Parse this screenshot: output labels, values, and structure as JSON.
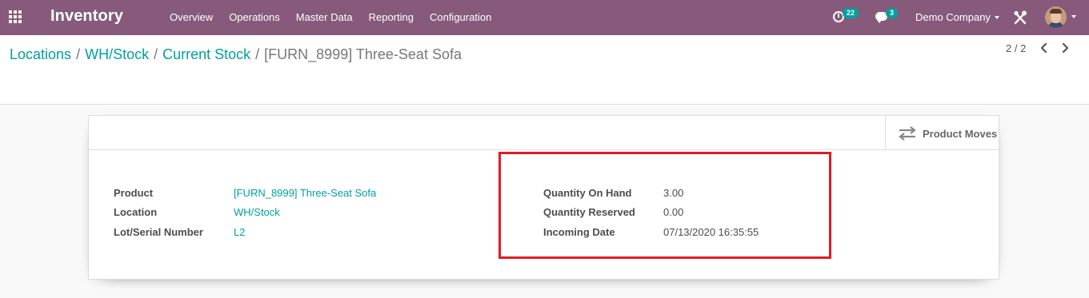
{
  "navbar": {
    "app_title": "Inventory",
    "menu": [
      "Overview",
      "Operations",
      "Master Data",
      "Reporting",
      "Configuration"
    ],
    "activity_count": "22",
    "message_count": "3",
    "company": "Demo Company",
    "icons": [
      "apps-grid-icon",
      "activity-clock-icon",
      "chat-bubble-icon",
      "tools-icon",
      "user-avatar"
    ]
  },
  "breadcrumb": {
    "items": [
      "Locations",
      "WH/Stock",
      "Current Stock"
    ],
    "separator": "/",
    "current": "[FURN_8999] Three-Seat Sofa"
  },
  "pager": {
    "value": "2 / 2"
  },
  "form": {
    "button_box": {
      "product_moves_label": "Product Moves"
    },
    "left": {
      "product_label": "Product",
      "product_value": "[FURN_8999] Three-Seat Sofa",
      "location_label": "Location",
      "location_value": "WH/Stock",
      "lot_label": "Lot/Serial Number",
      "lot_value": "L2"
    },
    "right": {
      "qty_on_hand_label": "Quantity On Hand",
      "qty_on_hand_value": "3.00",
      "qty_reserved_label": "Quantity Reserved",
      "qty_reserved_value": "0.00",
      "incoming_date_label": "Incoming Date",
      "incoming_date_value": "07/13/2020 16:35:55"
    }
  },
  "colors": {
    "navbar": "#875a7b",
    "link": "#00a09d",
    "badge": "#00a09d",
    "highlight": "#e31b23"
  }
}
